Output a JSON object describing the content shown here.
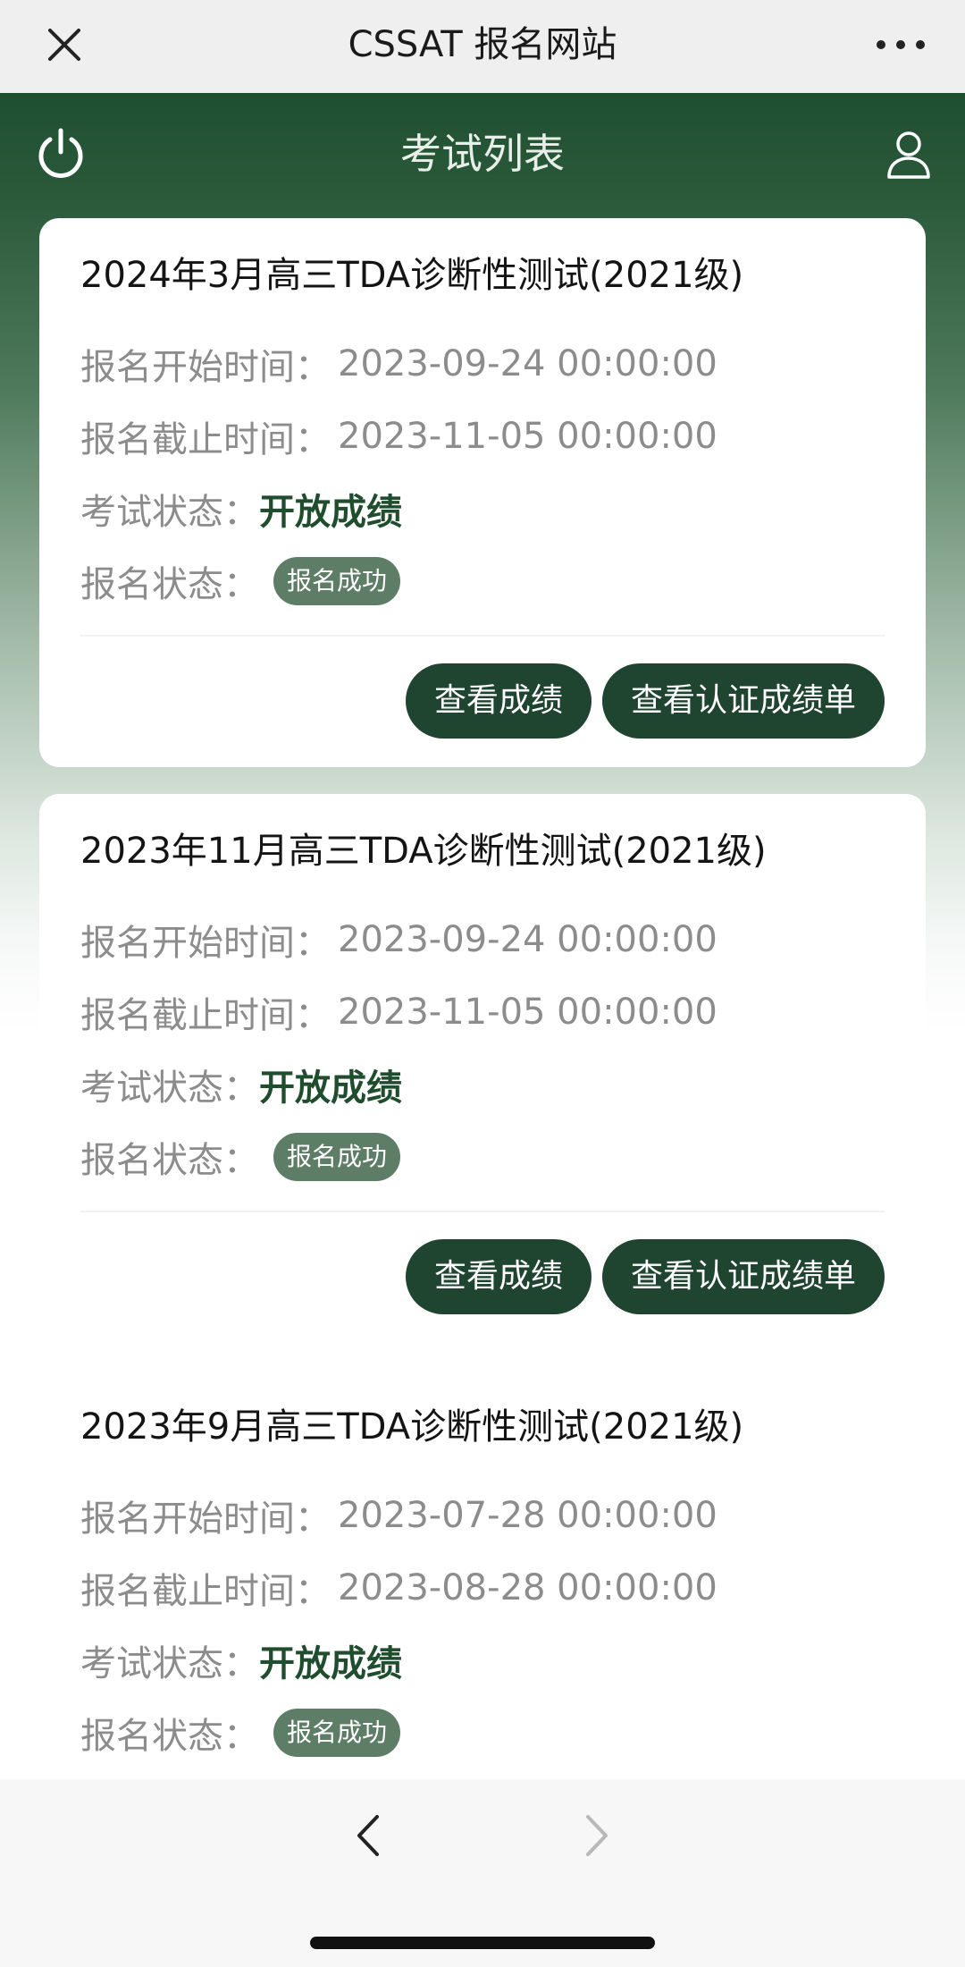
{
  "topbar": {
    "title": "CSSAT 报名网站",
    "close_icon": "close-icon",
    "more_icon": "more-icon"
  },
  "header": {
    "title": "考试列表",
    "power_icon": "power-icon",
    "user_icon": "user-icon"
  },
  "exams": [
    {
      "title": "2024年3月高三TDA诊断性测试(2021级)",
      "reg_start_label": "报名开始时间：",
      "reg_start_value": "2023-09-24 00:00:00",
      "reg_end_label": "报名截止时间：",
      "reg_end_value": "2023-11-05 00:00:00",
      "exam_status_label": "考试状态：",
      "exam_status_value": "开放成绩",
      "reg_status_label": "报名状态：",
      "reg_status_badge": "报名成功",
      "actions": [
        "查看成绩",
        "查看认证成绩单"
      ]
    },
    {
      "title": "2023年11月高三TDA诊断性测试(2021级)",
      "reg_start_label": "报名开始时间：",
      "reg_start_value": "2023-09-24 00:00:00",
      "reg_end_label": "报名截止时间：",
      "reg_end_value": "2023-11-05 00:00:00",
      "exam_status_label": "考试状态：",
      "exam_status_value": "开放成绩",
      "reg_status_label": "报名状态：",
      "reg_status_badge": "报名成功",
      "actions": [
        "查看成绩",
        "查看认证成绩单"
      ]
    },
    {
      "title": "2023年9月高三TDA诊断性测试(2021级)",
      "reg_start_label": "报名开始时间：",
      "reg_start_value": "2023-07-28 00:00:00",
      "reg_end_label": "报名截止时间：",
      "reg_end_value": "2023-08-28 00:00:00",
      "exam_status_label": "考试状态：",
      "exam_status_value": "开放成绩",
      "reg_status_label": "报名状态：",
      "reg_status_badge": "报名成功"
    }
  ],
  "bottombar": {
    "back_icon": "chevron-left-icon",
    "forward_icon": "chevron-right-icon"
  },
  "colors": {
    "brand_dark_green": "#1f4430",
    "header_green": "#2b5a3b",
    "status_green": "#1f4d2e",
    "badge_green": "#5d7d66",
    "muted_text": "#8c8c8c"
  }
}
